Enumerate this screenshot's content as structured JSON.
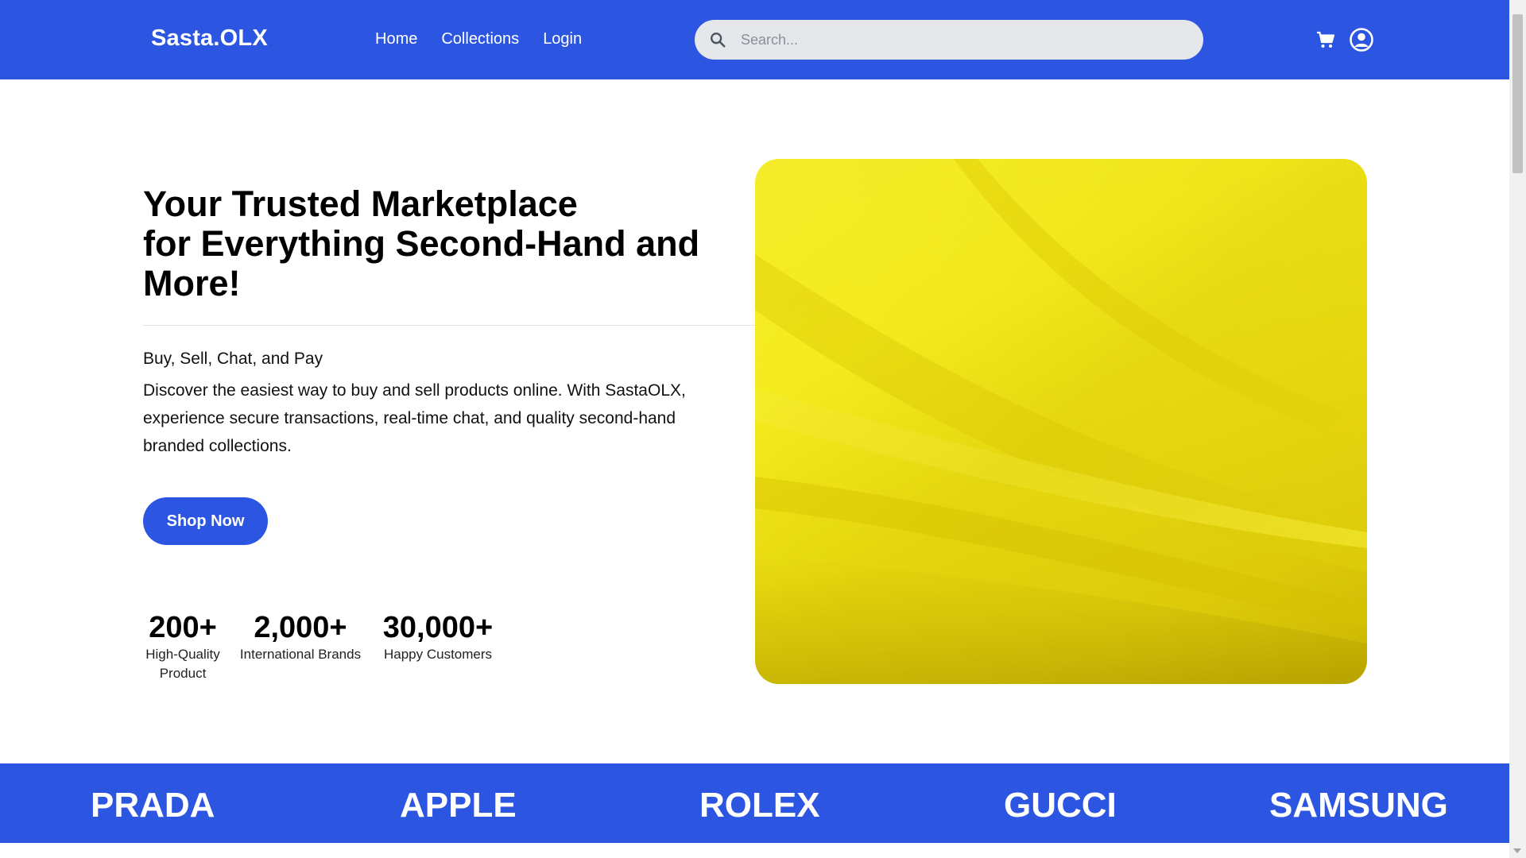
{
  "navbar": {
    "brand": "Sasta.OLX",
    "links": [
      "Home",
      "Collections",
      "Login"
    ],
    "search_placeholder": "Search...",
    "icons": [
      "search-icon",
      "cart-icon",
      "user-circle-icon"
    ]
  },
  "hero": {
    "title_lines": [
      "Your Trusted Marketplace",
      "for Everything Second-Hand and",
      "More!"
    ],
    "tagline": "Buy, Sell, Chat, and Pay",
    "description": "Discover the easiest way to buy and sell products online. With SastaOLX, experience secure transactions, real-time chat, and quality second-hand branded collections.",
    "cta_label": "Shop Now",
    "stats": [
      {
        "value": "200+",
        "label": "High-Quality Product"
      },
      {
        "value": "2,000+",
        "label": "International Brands"
      },
      {
        "value": "30,000+",
        "label": "Happy Customers"
      }
    ]
  },
  "brands": [
    "PRADA",
    "APPLE",
    "ROLEX",
    "GUCCI",
    "SAMSUNG"
  ],
  "colors": {
    "primary": "#2c56e1",
    "search_bg": "#e5e7eb",
    "hero_image_yellow": "#f7ef1f"
  }
}
